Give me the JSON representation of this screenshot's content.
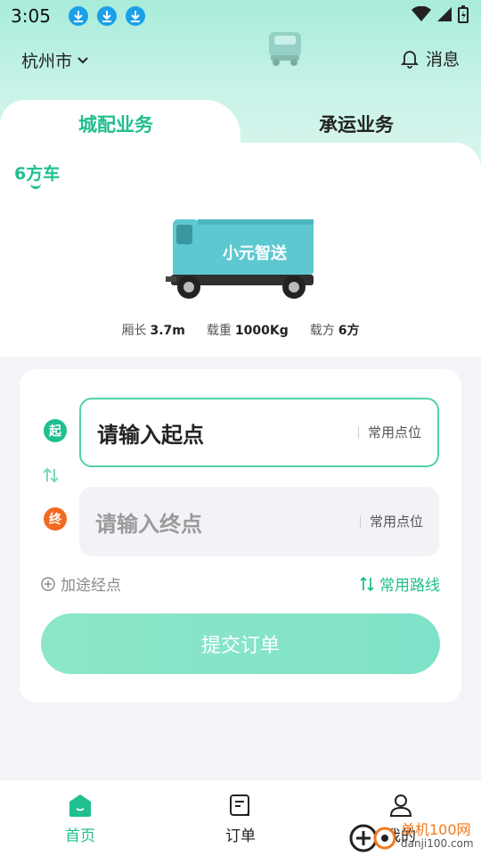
{
  "status_bar": {
    "time": "3:05"
  },
  "header": {
    "city": "杭州市",
    "messages": "消息"
  },
  "tabs": [
    {
      "label": "城配业务",
      "active": true
    },
    {
      "label": "承运业务",
      "active": false
    }
  ],
  "vehicle": {
    "type_label": "6方车",
    "brand_text": "小元智送",
    "specs": [
      {
        "label": "厢长",
        "value": "3.7m"
      },
      {
        "label": "载重",
        "value": "1000Kg"
      },
      {
        "label": "载方",
        "value": "6方"
      }
    ]
  },
  "form": {
    "start_badge": "起",
    "end_badge": "终",
    "start_placeholder": "请输入起点",
    "end_placeholder": "请输入终点",
    "common_point_label": "常用点位",
    "add_waypoint": "加途经点",
    "common_routes": "常用路线",
    "submit_label": "提交订单"
  },
  "bottom_nav": [
    {
      "label": "首页",
      "active": true
    },
    {
      "label": "订单",
      "active": false
    },
    {
      "label": "我的",
      "active": false
    }
  ],
  "watermark": {
    "title": "单机100网",
    "url": "danji100.com"
  },
  "colors": {
    "accent": "#1fbf8f",
    "end_badge": "#f26a21",
    "download_icon": "#1aa0e8"
  }
}
